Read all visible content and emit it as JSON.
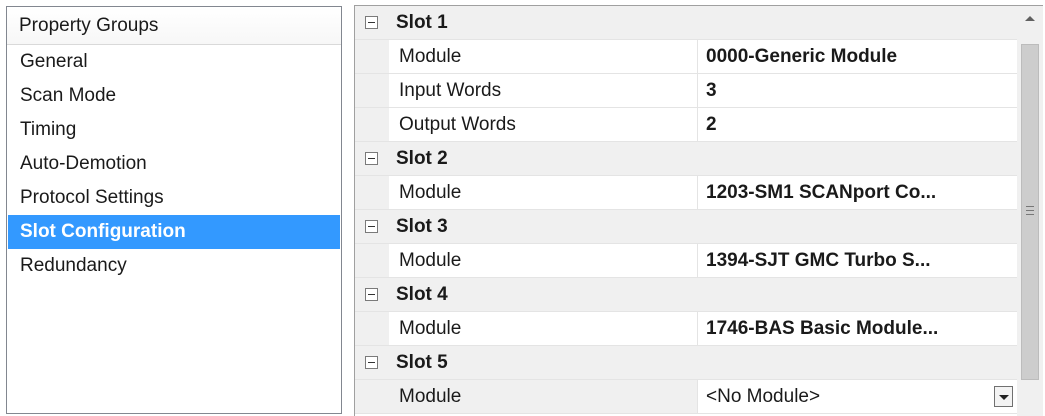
{
  "left": {
    "header": "Property Groups",
    "items": [
      "General",
      "Scan Mode",
      "Timing",
      "Auto-Demotion",
      "Protocol Settings",
      "Slot Configuration",
      "Redundancy"
    ],
    "selected_index": 5
  },
  "grid": {
    "slots": [
      {
        "label": "Slot 1",
        "props": [
          {
            "name": "Module",
            "value": "0000-Generic Module"
          },
          {
            "name": "Input Words",
            "value": "3"
          },
          {
            "name": "Output Words",
            "value": "2"
          }
        ]
      },
      {
        "label": "Slot 2",
        "props": [
          {
            "name": "Module",
            "value": "1203-SM1 SCANport Co..."
          }
        ]
      },
      {
        "label": "Slot 3",
        "props": [
          {
            "name": "Module",
            "value": "1394-SJT GMC Turbo S..."
          }
        ]
      },
      {
        "label": "Slot 4",
        "props": [
          {
            "name": "Module",
            "value": "1746-BAS Basic Module..."
          }
        ]
      },
      {
        "label": "Slot 5",
        "props": [
          {
            "name": "Module",
            "value": "<No Module>"
          }
        ]
      }
    ]
  },
  "colors": {
    "selection": "#3399ff",
    "category_bg": "#f0f0f0"
  }
}
